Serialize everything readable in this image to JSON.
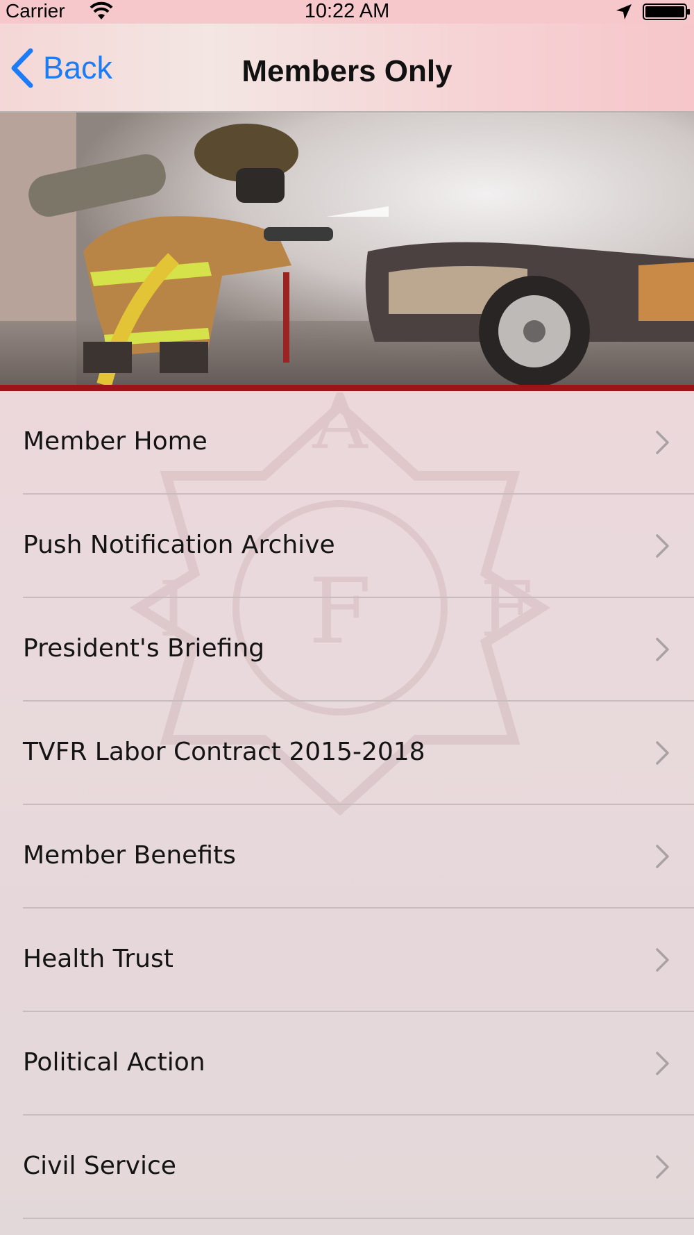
{
  "status_bar": {
    "carrier": "Carrier",
    "time": "10:22 AM",
    "icons": [
      "wifi-icon",
      "location-arrow-icon",
      "battery-icon"
    ]
  },
  "nav": {
    "back_label": "Back",
    "title": "Members Only",
    "back_icon": "chevron-left-icon",
    "accent_color": "#1b7cf6"
  },
  "hero": {
    "description_icon": "firefighter-hero-image"
  },
  "menu": {
    "items": [
      {
        "label": "Member Home"
      },
      {
        "label": "Push Notification Archive"
      },
      {
        "label": "President's Briefing"
      },
      {
        "label": "TVFR Labor Contract 2015-2018"
      },
      {
        "label": "Member Benefits"
      },
      {
        "label": "Health Trust"
      },
      {
        "label": "Political Action"
      },
      {
        "label": "Civil Service"
      }
    ],
    "item_icon": "chevron-right-icon"
  },
  "colors": {
    "divider_red": "#9b1419",
    "status_bar_bg": "#f6c8cc"
  }
}
